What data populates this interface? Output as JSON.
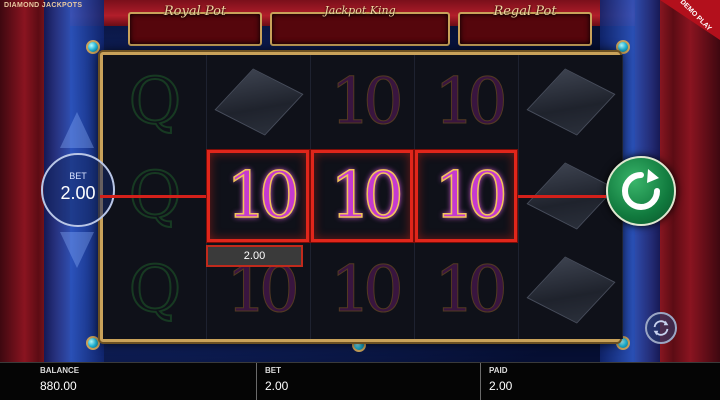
{
  "game": {
    "title": "DIAMOND JACKPOTS",
    "demo_label": "DEMO PLAY"
  },
  "jackpots": [
    {
      "label": "Royal Pot",
      "value": ""
    },
    {
      "label": "Jackpot King",
      "value": ""
    },
    {
      "label": "Regal Pot",
      "value": ""
    }
  ],
  "reels": [
    [
      "Q",
      "Q",
      "Q"
    ],
    [
      "cube",
      "10",
      "10"
    ],
    [
      "10",
      "10",
      "10"
    ],
    [
      "10",
      "10",
      "10"
    ],
    [
      "cube",
      "cube",
      "cube"
    ]
  ],
  "win": {
    "amount": "2.00",
    "winning_symbol": "10",
    "row": 2,
    "reels": [
      2,
      3,
      4
    ]
  },
  "bet_control": {
    "label": "BET",
    "value": "2.00"
  },
  "bottom_bar": {
    "balance_label": "BALANCE",
    "balance_value": "880.00",
    "bet_label": "BET",
    "bet_value": "2.00",
    "paid_label": "PAID",
    "paid_value": "2.00"
  },
  "icons": {
    "spin": "spin-arrow-icon",
    "autoplay": "autoplay-icon"
  },
  "colors": {
    "win_highlight": "#e0261b",
    "spin_button": "#117a3e",
    "frame_gold": "#c9a25a"
  }
}
